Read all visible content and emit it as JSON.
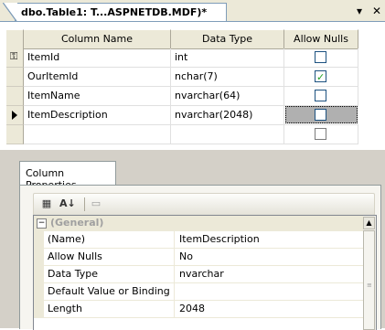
{
  "document_tab": {
    "title": "dbo.Table1: T...ASPNETDB.MDF)*",
    "dropdown_glyph": "▾",
    "close_glyph": "✕"
  },
  "grid": {
    "headers": [
      "Column Name",
      "Data Type",
      "Allow Nulls"
    ],
    "rows": [
      {
        "name": "ItemId",
        "type": "int",
        "allow_nulls": false,
        "marker": "key-icon"
      },
      {
        "name": "OurItemId",
        "type": "nchar(7)",
        "allow_nulls": true,
        "marker": ""
      },
      {
        "name": "ItemName",
        "type": "nvarchar(64)",
        "allow_nulls": false,
        "marker": ""
      },
      {
        "name": "ItemDescription",
        "type": "nvarchar(2048)",
        "allow_nulls": false,
        "marker": "current-row-arrow-icon"
      },
      {
        "name": "",
        "type": "",
        "allow_nulls": false,
        "marker": ""
      }
    ]
  },
  "column_properties": {
    "tab_label": "Column Properties",
    "category": "(General)",
    "properties": [
      {
        "name": "(Name)",
        "value": "ItemDescription"
      },
      {
        "name": "Allow Nulls",
        "value": "No"
      },
      {
        "name": "Data Type",
        "value": "nvarchar"
      },
      {
        "name": "Default Value or Binding",
        "value": ""
      },
      {
        "name": "Length",
        "value": "2048"
      }
    ]
  }
}
